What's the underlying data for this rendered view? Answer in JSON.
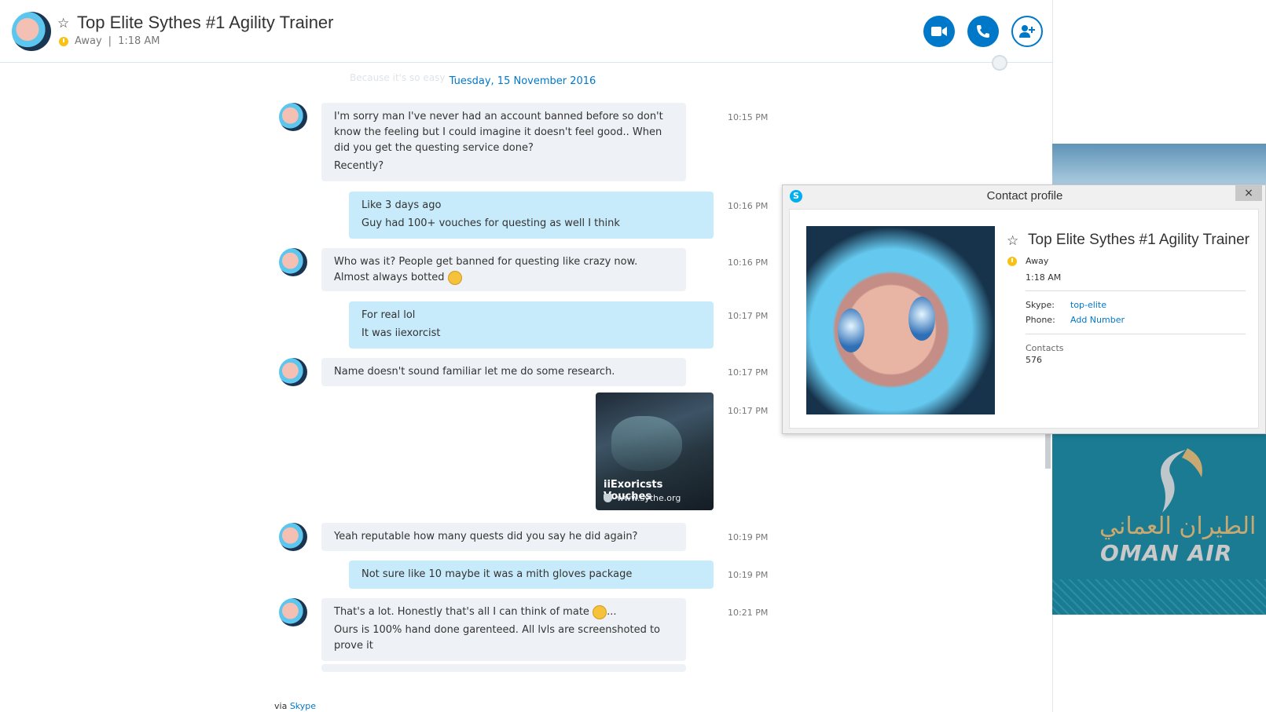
{
  "header": {
    "title": "Top Elite Sythes #1 Agility Trainer",
    "status": "Away",
    "time": "1:18 AM",
    "separator": "|",
    "buttons": {
      "video": "video-camera-icon",
      "call": "phone-icon",
      "add": "add-person-icon"
    }
  },
  "chat": {
    "date": "Tuesday, 15 November 2016",
    "faded_text": "Because it's so easy",
    "messages": [
      {
        "dir": "in",
        "time": "10:15 PM",
        "lines": [
          "I'm sorry man I've never had an account banned before so don't know the feeling but I could imagine it doesn't feel good.. When did you get the questing service done?",
          "Recently?"
        ]
      },
      {
        "dir": "out",
        "time": "10:16 PM",
        "lines": [
          "Like 3 days ago",
          "Guy had 100+ vouches for questing as well I think"
        ]
      },
      {
        "dir": "in",
        "time": "10:16 PM",
        "lines": [
          "Who was it? People get banned for questing like crazy now. Almost always botted"
        ]
      },
      {
        "dir": "out",
        "time": "10:17 PM",
        "lines": [
          "For real lol",
          "It was iiexorcist"
        ]
      },
      {
        "dir": "in",
        "time": "10:17 PM",
        "lines": [
          "Name doesn't sound familiar let me do some research."
        ]
      },
      {
        "dir": "out",
        "time": "10:17 PM",
        "link": {
          "title": "iiExoricsts Vouches",
          "url": "www.sythe.org"
        }
      },
      {
        "dir": "in",
        "time": "10:19 PM",
        "lines": [
          "Yeah reputable how many quests did you say he did again?"
        ]
      },
      {
        "dir": "out",
        "time": "10:19 PM",
        "lines": [
          "Not sure like 10 maybe it was a mith gloves package"
        ]
      },
      {
        "dir": "in",
        "time": "10:21 PM",
        "lines": [
          "That's a lot. Honestly that's all I can think of mate",
          "Ours is 100% hand done garenteed. All lvls are screenshoted to prove it"
        ]
      }
    ],
    "via": "via",
    "via_link": "Skype"
  },
  "ad": {
    "arabic": "الطيران العماني",
    "name": "OMAN AIR"
  },
  "profile_dialog": {
    "title": "Contact profile",
    "close": "×",
    "skype_logo": "S",
    "name": "Top Elite Sythes #1 Agility Trainer",
    "status": "Away",
    "time": "1:18 AM",
    "skype_label": "Skype:",
    "skype_value": "top-elite",
    "phone_label": "Phone:",
    "phone_value": "Add Number",
    "contacts_label": "Contacts",
    "contacts_value": "576"
  },
  "colors": {
    "accent": "#0078ca",
    "incoming": "#eef1f6",
    "outgoing": "#c7ebfb",
    "away": "#f8c215"
  }
}
